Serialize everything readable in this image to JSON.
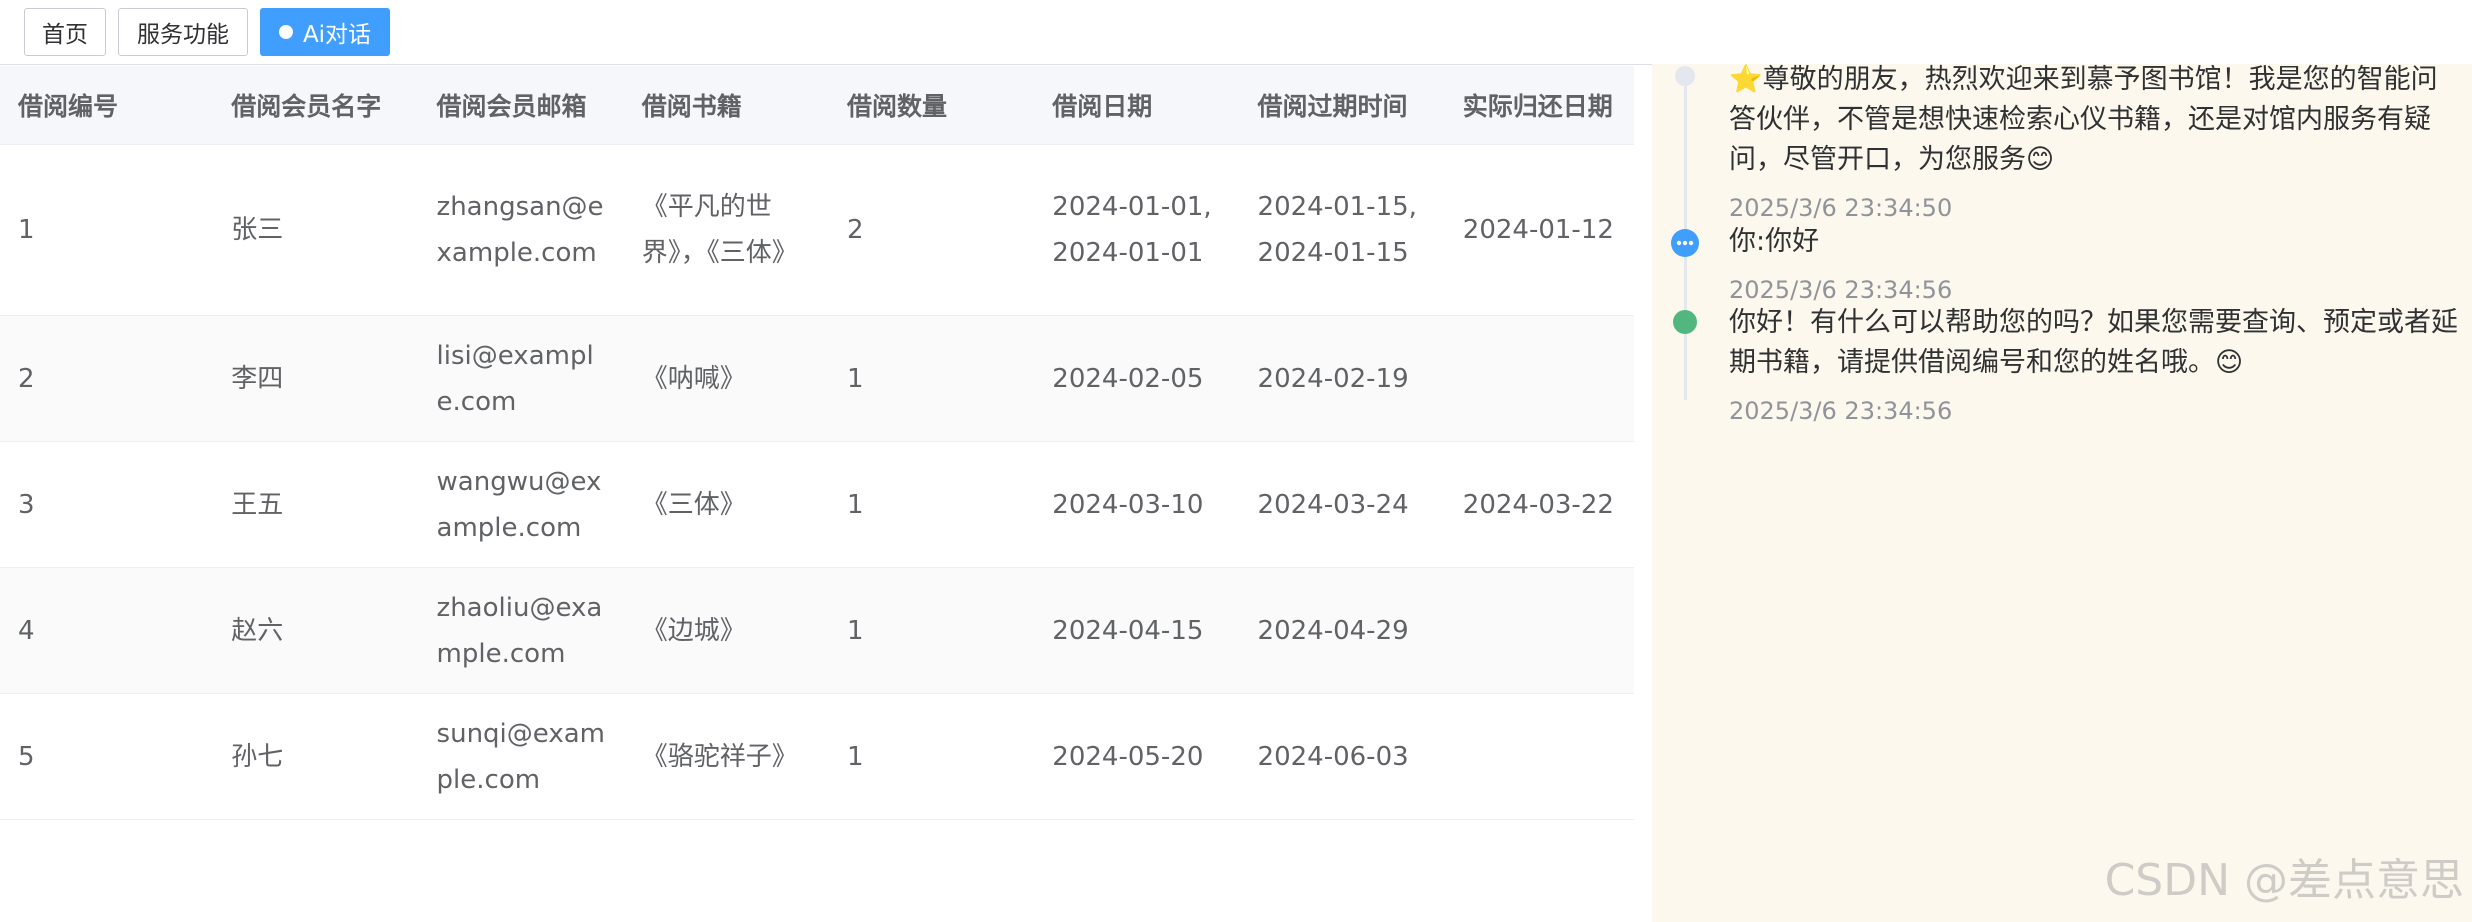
{
  "tabs": [
    {
      "label": "首页",
      "active": false
    },
    {
      "label": "服务功能",
      "active": false
    },
    {
      "label": "Ai对话",
      "active": true
    }
  ],
  "table": {
    "headers": [
      "借阅编号",
      "借阅会员名字",
      "借阅会员邮箱",
      "借阅书籍",
      "借阅数量",
      "借阅日期",
      "借阅过期时间",
      "实际归还日期"
    ],
    "rows": [
      {
        "id": "1",
        "name": "张三",
        "email": "zhangsan@example.com",
        "books": "《平凡的世界》，《三体》",
        "qty": "2",
        "borrow_date": "2024-01-01, 2024-01-01",
        "due_date": "2024-01-15, 2024-01-15",
        "return_date": "2024-01-12"
      },
      {
        "id": "2",
        "name": "李四",
        "email": "lisi@example.com",
        "books": "《呐喊》",
        "qty": "1",
        "borrow_date": "2024-02-05",
        "due_date": "2024-02-19",
        "return_date": ""
      },
      {
        "id": "3",
        "name": "王五",
        "email": "wangwu@example.com",
        "books": "《三体》",
        "qty": "1",
        "borrow_date": "2024-03-10",
        "due_date": "2024-03-24",
        "return_date": "2024-03-22"
      },
      {
        "id": "4",
        "name": "赵六",
        "email": "zhaoliu@example.com",
        "books": "《边城》",
        "qty": "1",
        "borrow_date": "2024-04-15",
        "due_date": "2024-04-29",
        "return_date": ""
      },
      {
        "id": "5",
        "name": "孙七",
        "email": "sunqi@example.com",
        "books": "《骆驼祥子》",
        "qty": "1",
        "borrow_date": "2024-05-20",
        "due_date": "2024-06-03",
        "return_date": ""
      }
    ]
  },
  "chat": {
    "messages": [
      {
        "text": "⭐尊敬的朋友，热烈欢迎来到慕予图书馆！我是您的智能问答伙伴，不管是想快速检索心仪书籍，还是对馆内服务有疑问，尽管开口，为您服务😊",
        "time": "2025/3/6 23:34:50",
        "node": "system"
      },
      {
        "text": "你:你好",
        "time": "2025/3/6 23:34:56",
        "node": "user"
      },
      {
        "text": "你好！有什么可以帮助您的吗？如果您需要查询、预定或者延期书籍，请提供借阅编号和您的姓名哦。😊",
        "time": "2025/3/6 23:34:56",
        "node": "assistant"
      }
    ]
  },
  "watermark": "CSDN @差点意思",
  "colors": {
    "accent": "#409eff",
    "system_node": "#e4e7ed",
    "user_node": "#409eff",
    "assistant_node": "#52b77f",
    "chat_bg": "#fdf8ee"
  }
}
